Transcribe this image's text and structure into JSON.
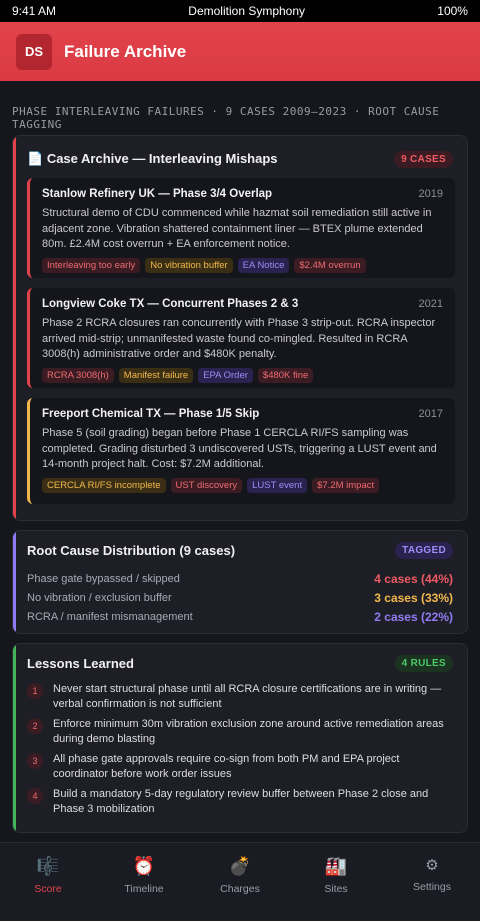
{
  "status_bar": {
    "time": "9:41 AM",
    "title": "Demolition Symphony",
    "battery": "100%"
  },
  "header": {
    "logo_text": "DS",
    "title": "Failure Archive"
  },
  "section_label": "PHASE INTERLEAVING FAILURES · 9 CASES 2009–2023 · ROOT CAUSE TAGGING",
  "archive": {
    "icon": "📄",
    "title": "Case Archive — Interleaving Mishaps",
    "badge": "9 CASES",
    "cases": [
      {
        "title": "Stanlow Refinery UK — Phase 3/4 Overlap",
        "year": "2019",
        "body": "Structural demo of CDU commenced while hazmat soil remediation still active in adjacent zone. Vibration shattered containment liner — BTEX plume extended 80m. £2.4M cost overrun + EA enforcement notice.",
        "tags": [
          "Interleaving too early",
          "No vibration buffer",
          "EA Notice",
          "$2.4M overrun"
        ]
      },
      {
        "title": "Longview Coke TX — Concurrent Phases 2 & 3",
        "year": "2021",
        "body": "Phase 2 RCRA closures ran concurrently with Phase 3 strip-out. RCRA inspector arrived mid-strip; unmanifested waste found co-mingled. Resulted in RCRA 3008(h) administrative order and $480K penalty.",
        "tags": [
          "RCRA 3008(h)",
          "Manifest failure",
          "EPA Order",
          "$480K fine"
        ]
      },
      {
        "title": "Freeport Chemical TX — Phase 1/5 Skip",
        "year": "2017",
        "body": "Phase 5 (soil grading) began before Phase 1 CERCLA RI/FS sampling was completed. Grading disturbed 3 undiscovered USTs, triggering a LUST event and 14-month project halt. Cost: $7.2M additional.",
        "tags": [
          "CERCLA RI/FS incomplete",
          "UST discovery",
          "LUST event",
          "$7.2M impact"
        ]
      }
    ]
  },
  "root_cause": {
    "title": "Root Cause Distribution (9 cases)",
    "badge": "TAGGED",
    "rows": [
      {
        "label": "Phase gate bypassed / skipped",
        "value": "4 cases (44%)",
        "color": "#ef5a63"
      },
      {
        "label": "No vibration / exclusion buffer",
        "value": "3 cases (33%)",
        "color": "#f2b84b"
      },
      {
        "label": "RCRA / manifest mismanagement",
        "value": "2 cases (22%)",
        "color": "#8f7cf2"
      }
    ]
  },
  "lessons": {
    "title": "Lessons Learned",
    "badge": "4 RULES",
    "items": [
      {
        "num": "1",
        "text": "Never start structural phase until all RCRA closure certifications are in writing — verbal confirmation is not sufficient"
      },
      {
        "num": "2",
        "text": "Enforce minimum 30m vibration exclusion zone around active remediation areas during demo blasting"
      },
      {
        "num": "3",
        "text": "All phase gate approvals require co-sign from both PM and EPA project coordinator before work order issues"
      },
      {
        "num": "4",
        "text": "Build a mandatory 5-day regulatory review buffer between Phase 2 close and Phase 3 mobilization"
      }
    ]
  },
  "nav": [
    {
      "icon": "🎼",
      "label": "Score"
    },
    {
      "icon": "⏰",
      "label": "Timeline"
    },
    {
      "icon": "💣",
      "label": "Charges"
    },
    {
      "icon": "🏭",
      "label": "Sites"
    },
    {
      "icon": "⚙",
      "label": "Settings"
    }
  ],
  "colors": {
    "accent": "#e2434b",
    "amber": "#f2b84b",
    "purple": "#8f7cf2",
    "green": "#43b45a"
  }
}
